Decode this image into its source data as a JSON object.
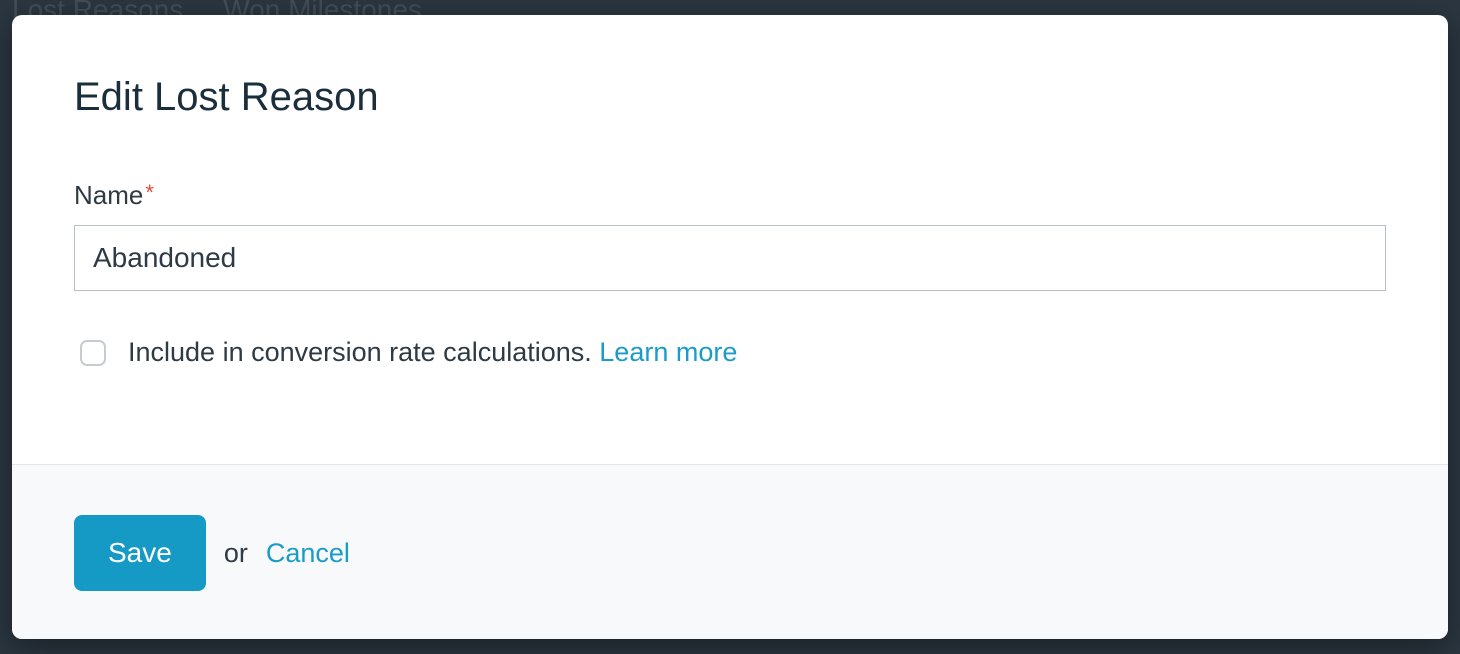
{
  "background": {
    "tab_left": "Lost Reasons",
    "tab_right": "Won Milestones"
  },
  "modal": {
    "title": "Edit Lost Reason",
    "name_field": {
      "label": "Name",
      "required_marker": "*",
      "value": "Abandoned"
    },
    "checkbox": {
      "checked": false,
      "label": "Include in conversion rate calculations.",
      "learn_more": "Learn more"
    },
    "footer": {
      "save": "Save",
      "or": "or",
      "cancel": "Cancel"
    }
  }
}
